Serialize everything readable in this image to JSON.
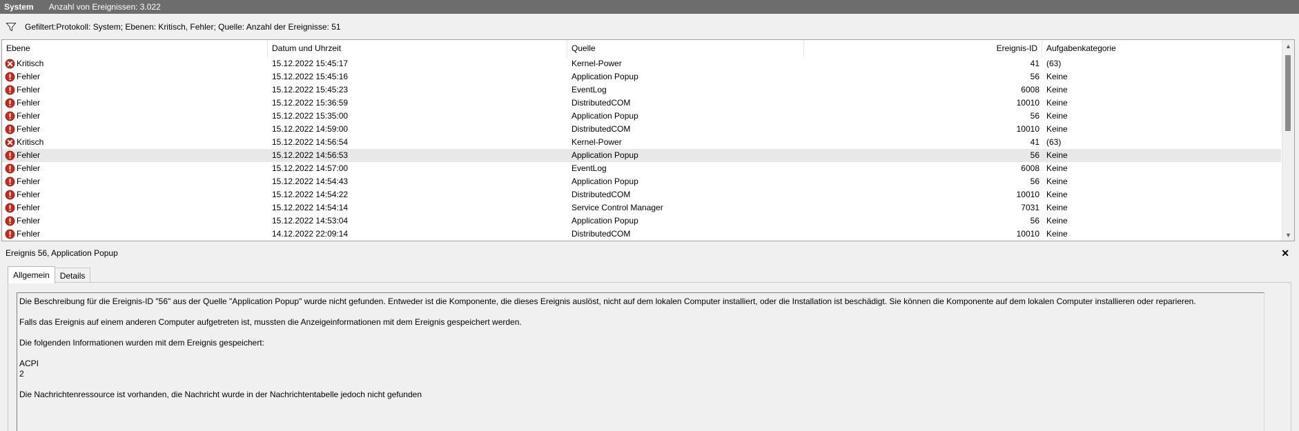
{
  "title": {
    "name": "System",
    "event_count": "Anzahl von Ereignissen: 3.022"
  },
  "filter": {
    "icon": "funnel-icon",
    "text": "Gefiltert:Protokoll: System; Ebenen: Kritisch, Fehler; Quelle:  Anzahl der Ereignisse: 51"
  },
  "columns": {
    "level": "Ebene",
    "date": "Datum und Uhrzeit",
    "source": "Quelle",
    "event_id": "Ereignis-ID",
    "category": "Aufgabenkategorie"
  },
  "events": [
    {
      "level": "Kritisch",
      "icon": "critical-icon",
      "date": "15.12.2022 15:45:17",
      "source": "Kernel-Power",
      "event_id": "41",
      "category": "(63)"
    },
    {
      "level": "Fehler",
      "icon": "error-icon",
      "date": "15.12.2022 15:45:16",
      "source": "Application Popup",
      "event_id": "56",
      "category": "Keine"
    },
    {
      "level": "Fehler",
      "icon": "error-icon",
      "date": "15.12.2022 15:45:23",
      "source": "EventLog",
      "event_id": "6008",
      "category": "Keine"
    },
    {
      "level": "Fehler",
      "icon": "error-icon",
      "date": "15.12.2022 15:36:59",
      "source": "DistributedCOM",
      "event_id": "10010",
      "category": "Keine"
    },
    {
      "level": "Fehler",
      "icon": "error-icon",
      "date": "15.12.2022 15:35:00",
      "source": "Application Popup",
      "event_id": "56",
      "category": "Keine"
    },
    {
      "level": "Fehler",
      "icon": "error-icon",
      "date": "15.12.2022 14:59:00",
      "source": "DistributedCOM",
      "event_id": "10010",
      "category": "Keine"
    },
    {
      "level": "Kritisch",
      "icon": "critical-icon",
      "date": "15.12.2022 14:56:54",
      "source": "Kernel-Power",
      "event_id": "41",
      "category": "(63)"
    },
    {
      "level": "Fehler",
      "icon": "error-icon",
      "date": "15.12.2022 14:56:53",
      "source": "Application Popup",
      "event_id": "56",
      "category": "Keine",
      "selected": true
    },
    {
      "level": "Fehler",
      "icon": "error-icon",
      "date": "15.12.2022 14:57:00",
      "source": "EventLog",
      "event_id": "6008",
      "category": "Keine"
    },
    {
      "level": "Fehler",
      "icon": "error-icon",
      "date": "15.12.2022 14:54:43",
      "source": "Application Popup",
      "event_id": "56",
      "category": "Keine"
    },
    {
      "level": "Fehler",
      "icon": "error-icon",
      "date": "15.12.2022 14:54:22",
      "source": "DistributedCOM",
      "event_id": "10010",
      "category": "Keine"
    },
    {
      "level": "Fehler",
      "icon": "error-icon",
      "date": "15.12.2022 14:54:14",
      "source": "Service Control Manager",
      "event_id": "7031",
      "category": "Keine"
    },
    {
      "level": "Fehler",
      "icon": "error-icon",
      "date": "15.12.2022 14:53:04",
      "source": "Application Popup",
      "event_id": "56",
      "category": "Keine"
    },
    {
      "level": "Fehler",
      "icon": "error-icon",
      "date": "14.12.2022 22:09:14",
      "source": "DistributedCOM",
      "event_id": "10010",
      "category": "Keine"
    }
  ],
  "detail": {
    "title": "Ereignis 56, Application Popup",
    "close": "✕",
    "tabs": [
      "Allgemein",
      "Details"
    ],
    "active_tab": "Allgemein",
    "description_lines": [
      "Die Beschreibung für die Ereignis-ID \"56\" aus der Quelle \"Application Popup\" wurde nicht gefunden. Entweder ist die Komponente, die dieses Ereignis auslöst, nicht auf dem lokalen Computer installiert, oder die Installation ist beschädigt. Sie können die Komponente auf dem lokalen Computer installieren oder reparieren.",
      "",
      "Falls das Ereignis auf einem anderen Computer aufgetreten ist, mussten die Anzeigeinformationen mit dem Ereignis gespeichert werden.",
      "",
      "Die folgenden Informationen wurden mit dem Ereignis gespeichert:",
      "",
      "ACPI",
      "2",
      "",
      "Die Nachrichtenressource ist vorhanden, die Nachricht wurde in der Nachrichtentabelle jedoch nicht gefunden"
    ]
  },
  "colors": {
    "titlebar_bg": "#6d6d6d",
    "icon_red": "#c42b1c",
    "selected_row": "#e8e8e8"
  }
}
